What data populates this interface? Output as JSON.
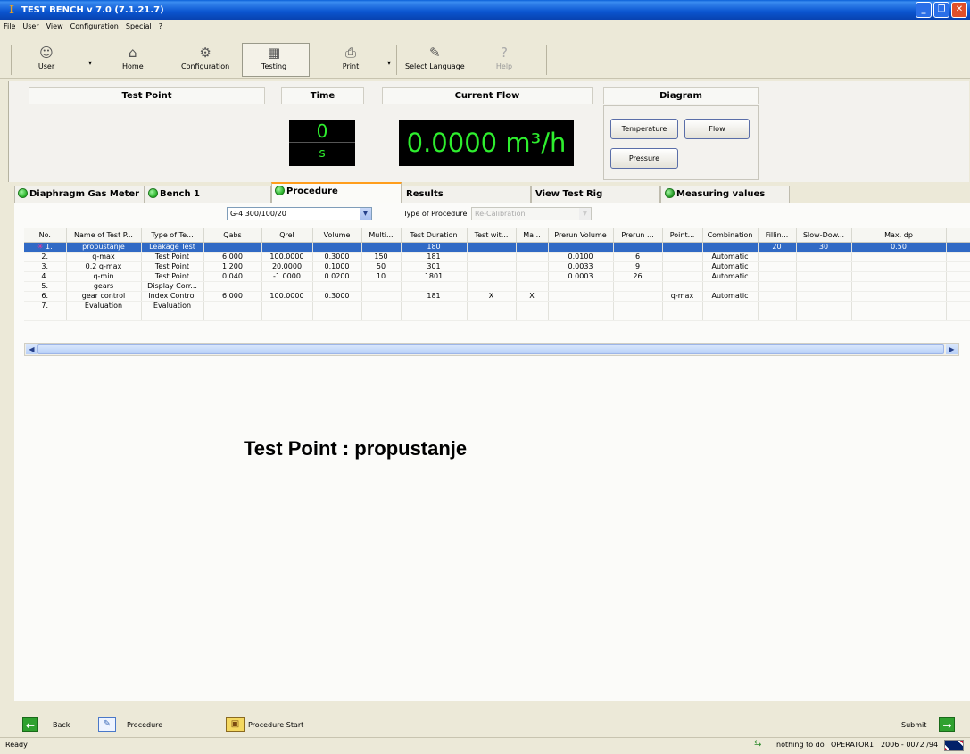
{
  "window": {
    "title": "TEST BENCH v 7.0 (7.1.21.7)"
  },
  "menu": [
    "File",
    "User",
    "View",
    "Configuration",
    "Special",
    "?"
  ],
  "toolbar": {
    "user": "User",
    "home": "Home",
    "configuration": "Configuration",
    "testing": "Testing",
    "print": "Print",
    "select_language": "Select Language",
    "help": "Help"
  },
  "panels": {
    "test_point_header": "Test Point",
    "time_header": "Time",
    "time_value": "0",
    "time_unit": "s",
    "current_flow_header": "Current Flow",
    "current_flow_value": "0.0000 m³/h",
    "diagram_header": "Diagram",
    "diagram_buttons": {
      "temperature": "Temperature",
      "flow": "Flow",
      "pressure": "Pressure"
    }
  },
  "tabs": [
    {
      "label": "Diaphragm Gas Meter",
      "led": true
    },
    {
      "label": "Bench 1",
      "led": true
    },
    {
      "label": "Procedure",
      "led": true,
      "active": true
    },
    {
      "label": "Results",
      "led": false
    },
    {
      "label": "View Test Rig",
      "led": false
    },
    {
      "label": "Measuring values",
      "led": true
    }
  ],
  "procedure": {
    "selected_procedure": "G-4 300/100/20",
    "type_label": "Type of Procedure",
    "type_value": "Re-Calibration"
  },
  "grid": {
    "columns": [
      "No.",
      "Name of Test P...",
      "Type of Te...",
      "Qabs",
      "Qrel",
      "Volume",
      "Multi...",
      "Test Duration",
      "Test wit...",
      "Ma...",
      "Prerun Volume",
      "Prerun ...",
      "Point...",
      "Combination",
      "Fillin...",
      "Slow-Dow...",
      "Max. dp"
    ],
    "rows": [
      [
        "1.",
        "propustanje",
        "Leakage Test",
        "",
        "",
        "",
        "",
        "180",
        "",
        "",
        "",
        "",
        "",
        "",
        "20",
        "30",
        "0.50"
      ],
      [
        "2.",
        "q-max",
        "Test Point",
        "6.000",
        "100.0000",
        "0.3000",
        "150",
        "181",
        "",
        "",
        "0.0100",
        "6",
        "",
        "Automatic",
        "",
        "",
        ""
      ],
      [
        "3.",
        "0.2 q-max",
        "Test Point",
        "1.200",
        "20.0000",
        "0.1000",
        "50",
        "301",
        "",
        "",
        "0.0033",
        "9",
        "",
        "Automatic",
        "",
        "",
        ""
      ],
      [
        "4.",
        "q-min",
        "Test Point",
        "0.040",
        "-1.0000",
        "0.0200",
        "10",
        "1801",
        "",
        "",
        "0.0003",
        "26",
        "",
        "Automatic",
        "",
        "",
        ""
      ],
      [
        "5.",
        "gears",
        "Display Corr...",
        "",
        "",
        "",
        "",
        "",
        "",
        "",
        "",
        "",
        "",
        "",
        "",
        "",
        ""
      ],
      [
        "6.",
        "gear control",
        "Index Control",
        "6.000",
        "100.0000",
        "0.3000",
        "",
        "181",
        "X",
        "X",
        "",
        "",
        "q-max",
        "Automatic",
        "",
        "",
        ""
      ],
      [
        "7.",
        "Evaluation",
        "Evaluation",
        "",
        "",
        "",
        "",
        "",
        "",
        "",
        "",
        "",
        "",
        "",
        "",
        "",
        ""
      ]
    ]
  },
  "current_test_point": "Test Point  :  propustanje",
  "bottom": {
    "back": "Back",
    "procedure": "Procedure",
    "procedure_start": "Procedure Start",
    "submit": "Submit"
  },
  "status": {
    "ready": "Ready",
    "activity": "nothing to do",
    "operator": "OPERATOR1",
    "id": "2006 - 0072 /94"
  }
}
